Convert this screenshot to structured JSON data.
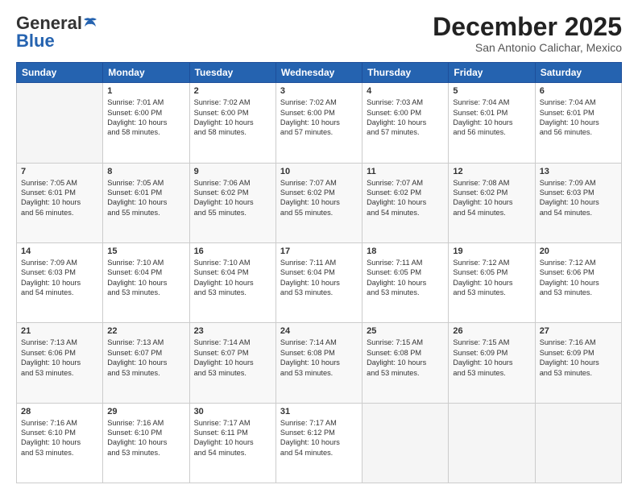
{
  "header": {
    "logo_general": "General",
    "logo_blue": "Blue",
    "month_title": "December 2025",
    "location": "San Antonio Calichar, Mexico"
  },
  "days_of_week": [
    "Sunday",
    "Monday",
    "Tuesday",
    "Wednesday",
    "Thursday",
    "Friday",
    "Saturday"
  ],
  "weeks": [
    [
      {
        "day": "",
        "content": ""
      },
      {
        "day": "1",
        "content": "Sunrise: 7:01 AM\nSunset: 6:00 PM\nDaylight: 10 hours\nand 58 minutes."
      },
      {
        "day": "2",
        "content": "Sunrise: 7:02 AM\nSunset: 6:00 PM\nDaylight: 10 hours\nand 58 minutes."
      },
      {
        "day": "3",
        "content": "Sunrise: 7:02 AM\nSunset: 6:00 PM\nDaylight: 10 hours\nand 57 minutes."
      },
      {
        "day": "4",
        "content": "Sunrise: 7:03 AM\nSunset: 6:00 PM\nDaylight: 10 hours\nand 57 minutes."
      },
      {
        "day": "5",
        "content": "Sunrise: 7:04 AM\nSunset: 6:01 PM\nDaylight: 10 hours\nand 56 minutes."
      },
      {
        "day": "6",
        "content": "Sunrise: 7:04 AM\nSunset: 6:01 PM\nDaylight: 10 hours\nand 56 minutes."
      }
    ],
    [
      {
        "day": "7",
        "content": "Sunrise: 7:05 AM\nSunset: 6:01 PM\nDaylight: 10 hours\nand 56 minutes."
      },
      {
        "day": "8",
        "content": "Sunrise: 7:05 AM\nSunset: 6:01 PM\nDaylight: 10 hours\nand 55 minutes."
      },
      {
        "day": "9",
        "content": "Sunrise: 7:06 AM\nSunset: 6:02 PM\nDaylight: 10 hours\nand 55 minutes."
      },
      {
        "day": "10",
        "content": "Sunrise: 7:07 AM\nSunset: 6:02 PM\nDaylight: 10 hours\nand 55 minutes."
      },
      {
        "day": "11",
        "content": "Sunrise: 7:07 AM\nSunset: 6:02 PM\nDaylight: 10 hours\nand 54 minutes."
      },
      {
        "day": "12",
        "content": "Sunrise: 7:08 AM\nSunset: 6:02 PM\nDaylight: 10 hours\nand 54 minutes."
      },
      {
        "day": "13",
        "content": "Sunrise: 7:09 AM\nSunset: 6:03 PM\nDaylight: 10 hours\nand 54 minutes."
      }
    ],
    [
      {
        "day": "14",
        "content": "Sunrise: 7:09 AM\nSunset: 6:03 PM\nDaylight: 10 hours\nand 54 minutes."
      },
      {
        "day": "15",
        "content": "Sunrise: 7:10 AM\nSunset: 6:04 PM\nDaylight: 10 hours\nand 53 minutes."
      },
      {
        "day": "16",
        "content": "Sunrise: 7:10 AM\nSunset: 6:04 PM\nDaylight: 10 hours\nand 53 minutes."
      },
      {
        "day": "17",
        "content": "Sunrise: 7:11 AM\nSunset: 6:04 PM\nDaylight: 10 hours\nand 53 minutes."
      },
      {
        "day": "18",
        "content": "Sunrise: 7:11 AM\nSunset: 6:05 PM\nDaylight: 10 hours\nand 53 minutes."
      },
      {
        "day": "19",
        "content": "Sunrise: 7:12 AM\nSunset: 6:05 PM\nDaylight: 10 hours\nand 53 minutes."
      },
      {
        "day": "20",
        "content": "Sunrise: 7:12 AM\nSunset: 6:06 PM\nDaylight: 10 hours\nand 53 minutes."
      }
    ],
    [
      {
        "day": "21",
        "content": "Sunrise: 7:13 AM\nSunset: 6:06 PM\nDaylight: 10 hours\nand 53 minutes."
      },
      {
        "day": "22",
        "content": "Sunrise: 7:13 AM\nSunset: 6:07 PM\nDaylight: 10 hours\nand 53 minutes."
      },
      {
        "day": "23",
        "content": "Sunrise: 7:14 AM\nSunset: 6:07 PM\nDaylight: 10 hours\nand 53 minutes."
      },
      {
        "day": "24",
        "content": "Sunrise: 7:14 AM\nSunset: 6:08 PM\nDaylight: 10 hours\nand 53 minutes."
      },
      {
        "day": "25",
        "content": "Sunrise: 7:15 AM\nSunset: 6:08 PM\nDaylight: 10 hours\nand 53 minutes."
      },
      {
        "day": "26",
        "content": "Sunrise: 7:15 AM\nSunset: 6:09 PM\nDaylight: 10 hours\nand 53 minutes."
      },
      {
        "day": "27",
        "content": "Sunrise: 7:16 AM\nSunset: 6:09 PM\nDaylight: 10 hours\nand 53 minutes."
      }
    ],
    [
      {
        "day": "28",
        "content": "Sunrise: 7:16 AM\nSunset: 6:10 PM\nDaylight: 10 hours\nand 53 minutes."
      },
      {
        "day": "29",
        "content": "Sunrise: 7:16 AM\nSunset: 6:10 PM\nDaylight: 10 hours\nand 53 minutes."
      },
      {
        "day": "30",
        "content": "Sunrise: 7:17 AM\nSunset: 6:11 PM\nDaylight: 10 hours\nand 54 minutes."
      },
      {
        "day": "31",
        "content": "Sunrise: 7:17 AM\nSunset: 6:12 PM\nDaylight: 10 hours\nand 54 minutes."
      },
      {
        "day": "",
        "content": ""
      },
      {
        "day": "",
        "content": ""
      },
      {
        "day": "",
        "content": ""
      }
    ]
  ]
}
